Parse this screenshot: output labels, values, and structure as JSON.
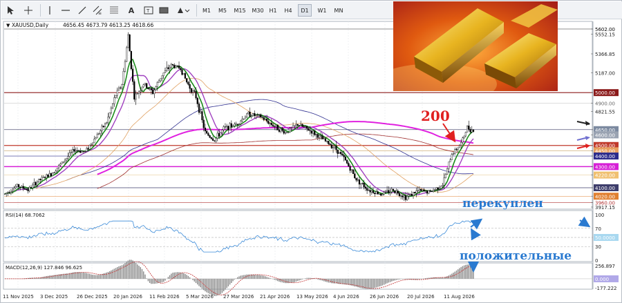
{
  "toolbar": {
    "tools": [
      "cursor-icon",
      "crosshair-icon",
      "vertical-line-icon",
      "horizontal-line-icon",
      "trendline-icon",
      "equidistant-channel-icon",
      "fibonacci-icon",
      "text-icon",
      "text-label-icon",
      "rectangle-icon",
      "shapes-menu-icon"
    ],
    "timeframes": [
      "M1",
      "M5",
      "M15",
      "M30",
      "H1",
      "H4",
      "D1",
      "W1",
      "MN"
    ],
    "active_timeframe": "D1"
  },
  "chart_header": {
    "symbol_label": "XAUUSD,Daily",
    "ohlc": "4656.45 4673.79 4613.25 4618.66"
  },
  "price_axis": {
    "labels": [
      "5602.00",
      "5552.15",
      "5366.85",
      "5187.00",
      "5000.00",
      "4900.00",
      "4821.55",
      "4650.00",
      "4600.00",
      "4500.00",
      "4450.00",
      "4400.00",
      "4300.00",
      "4220.00",
      "4100.00",
      "4020.00",
      "3960.00",
      "3917.15"
    ],
    "highlights": [
      {
        "label": "5602.00",
        "bg": "#ffffff",
        "fg": "#000000"
      },
      {
        "label": "5000.00",
        "bg": "#8b1a1a",
        "fg": "#ffffff"
      },
      {
        "label": "4900.00",
        "bg": "#ffffff",
        "fg": "#666666"
      },
      {
        "label": "4650.00",
        "bg": "#7c8aa0",
        "fg": "#ffffff"
      },
      {
        "label": "4600.00",
        "bg": "#9aa3b2",
        "fg": "#ffffff"
      },
      {
        "label": "4500.00",
        "bg": "#c0392b",
        "fg": "#ffffff"
      },
      {
        "label": "4450.00",
        "bg": "#e8a060",
        "fg": "#ffffff"
      },
      {
        "label": "4400.00",
        "bg": "#2c2c8c",
        "fg": "#ffffff"
      },
      {
        "label": "4300.00",
        "bg": "#d61fd6",
        "fg": "#ffffff"
      },
      {
        "label": "4220.00",
        "bg": "#f0c070",
        "fg": "#ffffff"
      },
      {
        "label": "4100.00",
        "bg": "#3d3d6b",
        "fg": "#ffffff"
      },
      {
        "label": "4020.00",
        "bg": "#e08030",
        "fg": "#ffffff"
      },
      {
        "label": "3960.00",
        "bg": "#ffffff",
        "fg": "#b03030"
      }
    ]
  },
  "time_axis": {
    "labels": [
      "11 Nov 2025",
      "3 Dec 2025",
      "26 Dec 2025",
      "20 Jan 2026",
      "11 Feb 2026",
      "5 Mar 2026",
      "27 Mar 2026",
      "21 Apr 2026",
      "13 May 2026",
      "4 Jun 2026",
      "26 Jun 2026",
      "20 Jul 2026",
      "11 Aug 2026"
    ]
  },
  "rsi": {
    "label": "RSI(14) 68.7062",
    "levels": [
      "100",
      "70",
      "50.0000",
      "30",
      "0"
    ]
  },
  "macd": {
    "label": "MACD(12,26,9) 127.846 96.625",
    "levels": [
      "256.897",
      "0.000",
      "-177.222"
    ]
  },
  "annotations": {
    "ma_period": "200",
    "overbought": "перекуплен",
    "positive": "положительные"
  },
  "colors": {
    "bull_candle": "#ffffff",
    "bear_candle": "#000000",
    "ema_fast": "#1a8a1a",
    "ema_mid": "#a040c0",
    "ma_orange": "#e0a060",
    "ma_blue": "#303090",
    "ma_200": "#e020e0",
    "ma_brown": "#a03030",
    "annotation_red": "#e02020",
    "annotation_blue": "#2a7ad0"
  }
}
